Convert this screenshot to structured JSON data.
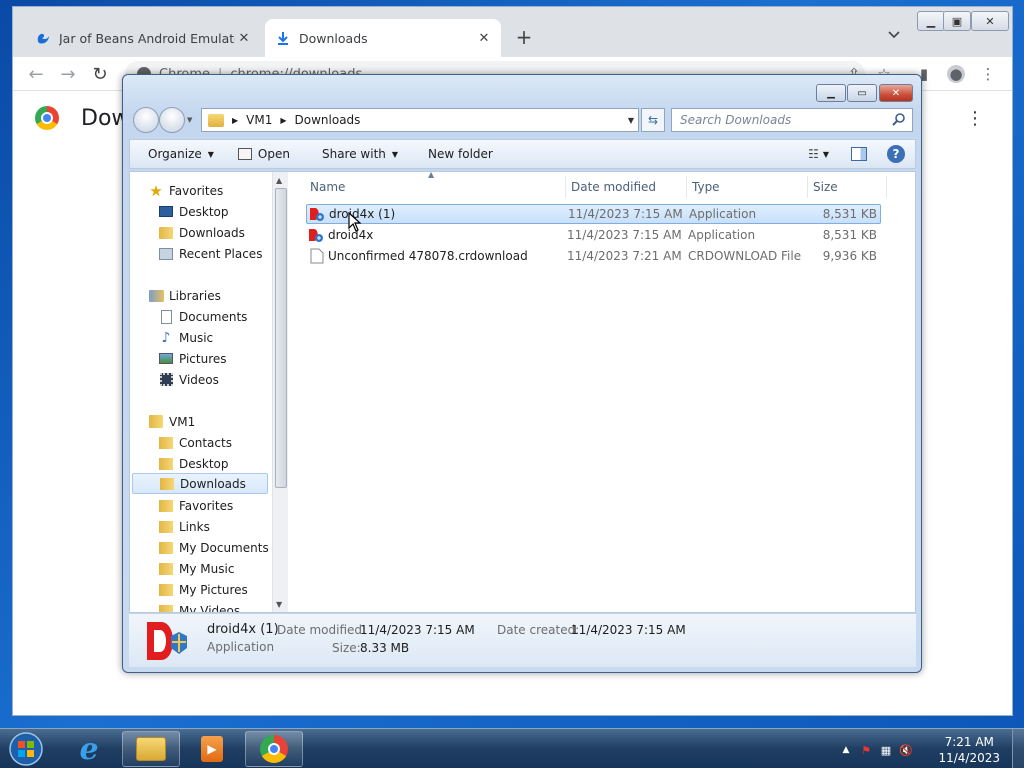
{
  "browser": {
    "tabs": [
      {
        "label": "Jar of Beans Android Emulator Dow",
        "active": false
      },
      {
        "label": "Downloads",
        "active": true
      }
    ],
    "newtab_symbol": "+",
    "omnibox": {
      "site_label": "Chrome",
      "url": "chrome://downloads"
    },
    "page_title": "Dow"
  },
  "explorer": {
    "breadcrumb": [
      "VM1",
      "Downloads"
    ],
    "search_placeholder": "Search Downloads",
    "commands": {
      "organize": "Organize",
      "open": "Open",
      "share_with": "Share with",
      "new_folder": "New folder"
    },
    "nav": {
      "favorites": {
        "label": "Favorites",
        "items": [
          "Desktop",
          "Downloads",
          "Recent Places"
        ]
      },
      "libraries": {
        "label": "Libraries",
        "items": [
          "Documents",
          "Music",
          "Pictures",
          "Videos"
        ]
      },
      "vm1": {
        "label": "VM1",
        "items": [
          "Contacts",
          "Desktop",
          "Downloads",
          "Favorites",
          "Links",
          "My Documents",
          "My Music",
          "My Pictures",
          "My Videos"
        ],
        "selected": "Downloads"
      }
    },
    "columns": {
      "name": "Name",
      "date_modified": "Date modified",
      "type": "Type",
      "size": "Size"
    },
    "files": [
      {
        "name": "droid4x (1)",
        "date": "11/4/2023 7:15 AM",
        "type": "Application",
        "size": "8,531 KB",
        "selected": true,
        "icon": "droid4x-icon"
      },
      {
        "name": "droid4x",
        "date": "11/4/2023 7:15 AM",
        "type": "Application",
        "size": "8,531 KB",
        "selected": false,
        "icon": "droid4x-icon"
      },
      {
        "name": "Unconfirmed 478078.crdownload",
        "date": "11/4/2023 7:21 AM",
        "type": "CRDOWNLOAD File",
        "size": "9,936 KB",
        "selected": false,
        "icon": "blank-file-icon"
      }
    ],
    "details": {
      "name": "droid4x (1)",
      "kind": "Application",
      "date_modified_label": "Date modified:",
      "date_modified": "11/4/2023 7:15 AM",
      "date_created_label": "Date created:",
      "date_created": "11/4/2023 7:15 AM",
      "size_label": "Size:",
      "size": "8.33 MB"
    }
  },
  "taskbar": {
    "clock": {
      "time": "7:21 AM",
      "date": "11/4/2023"
    },
    "items": [
      "start-orb",
      "internet-explorer",
      "windows-explorer",
      "media-player",
      "chrome"
    ]
  },
  "colors": {
    "desktop": "#0c57b8",
    "selection": "#c7e0fb",
    "chrome_tabstrip": "#dee1e6",
    "close_red": "#c9503a"
  }
}
